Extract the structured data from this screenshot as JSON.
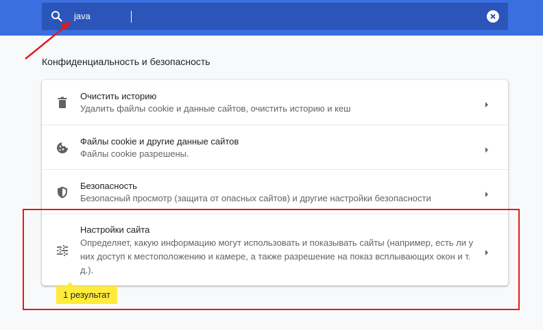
{
  "search": {
    "query": "java",
    "icon": "search-icon",
    "clear_icon": "close-icon"
  },
  "section": {
    "title": "Конфиденциальность и безопасность"
  },
  "rows": [
    {
      "icon": "trash-icon",
      "title": "Очистить историю",
      "subtitle": "Удалить файлы cookie и данные сайтов, очистить историю и кеш"
    },
    {
      "icon": "cookie-icon",
      "title": "Файлы cookie и другие данные сайтов",
      "subtitle": "Файлы cookie разрешены."
    },
    {
      "icon": "shield-icon",
      "title": "Безопасность",
      "subtitle": "Безопасный просмотр (защита от опасных сайтов) и другие настройки безопасности"
    },
    {
      "icon": "tune-icon",
      "title": "Настройки сайта",
      "subtitle": "Определяет, какую информацию могут использовать и показывать сайты (например, есть ли у них доступ к местоположению и камере, а также разрешение на показ всплывающих окон и т. д.)."
    }
  ],
  "result_badge": "1 результат",
  "colors": {
    "header": "#3b6fe0",
    "search_bg": "#2b55b8",
    "annotation": "#e01b1b",
    "badge": "#ffeb3b"
  }
}
